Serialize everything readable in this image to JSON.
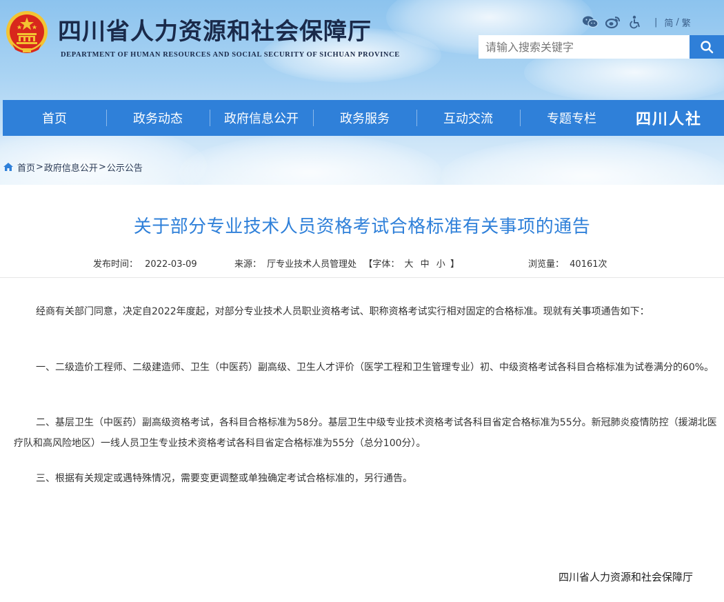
{
  "header": {
    "title": "四川省人力资源和社会保障厅",
    "subtitle": "DEPARTMENT OF HUMAN RESOURCES AND SOCIAL SECURITY OF SICHUAN PROVINCE",
    "tools": {
      "icons": [
        "wechat-icon",
        "weibo-icon",
        "accessibility-icon"
      ],
      "simplified": "简",
      "lang_sep": "/",
      "traditional": "繁",
      "separator": "|"
    },
    "search": {
      "placeholder": "请输入搜索关键字",
      "button_icon": "search-icon"
    }
  },
  "nav": {
    "items": [
      {
        "label": "首页"
      },
      {
        "label": "政务动态"
      },
      {
        "label": "政府信息公开"
      },
      {
        "label": "政务服务"
      },
      {
        "label": "互动交流"
      },
      {
        "label": "专题专栏"
      }
    ],
    "brand": "四川人社"
  },
  "breadcrumb": {
    "icon": "home-icon",
    "items": [
      "首页",
      "政府信息公开",
      "公示公告"
    ],
    "separator": ">"
  },
  "article": {
    "title": "关于部分专业技术人员资格考试合格标准有关事项的通告",
    "meta": {
      "date_label": "发布时间：",
      "date": "2022-03-09",
      "source_label": "来源：",
      "source": "厅专业技术人员管理处",
      "font_label_open": "【字体：",
      "font_large": "大",
      "font_medium": "中",
      "font_small": "小",
      "font_label_close": "】",
      "views_label": "浏览量：",
      "views": "40161次"
    },
    "paragraphs": [
      "经商有关部门同意，决定自2022年度起，对部分专业技术人员职业资格考试、职称资格考试实行相对固定的合格标准。现就有关事项通告如下：",
      "一、二级造价工程师、二级建造师、卫生（中医药）副高级、卫生人才评价（医学工程和卫生管理专业）初、中级资格考试各科目合格标准为试卷满分的60%。",
      "二、基层卫生（中医药）副高级资格考试，各科目合格标准为58分。基层卫生中级专业技术资格考试各科目省定合格标准为55分。新冠肺炎疫情防控（援湖北医疗队和高风险地区）一线人员卫生专业技术资格考试各科目省定合格标准为55分（总分100分）。",
      "三、根据有关规定或遇特殊情况，需要变更调整或单独确定考试合格标准的，另行通告。"
    ],
    "signature": "四川省人力资源和社会保障厅"
  },
  "colors": {
    "nav_bg": "#2f80d9",
    "title_blue": "#2f80d9",
    "emblem_red": "#d8271c",
    "emblem_gold": "#f3c432"
  }
}
